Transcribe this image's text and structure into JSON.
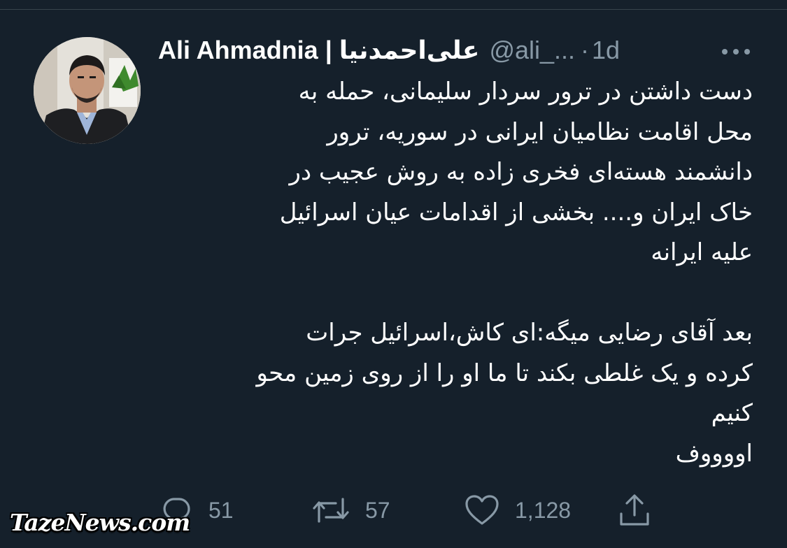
{
  "tweet": {
    "author": {
      "display_name": "Ali Ahmadnia | علی‌احمدنیا",
      "handle": "@ali_...",
      "separator": "·",
      "time": "1d"
    },
    "text_lines": [
      "دست داشتن در ترور سردار سلیمانی، حمله به",
      "محل اقامت نظامیان ایرانی در سوریه، ترور",
      "دانشمند هسته‌ای فخری زاده به روش عجیب در",
      "خاک ایران و.... بخشی از اقدامات عیان اسرائیل",
      "علیه ایرانه",
      "",
      "بعد آقای رضایی میگه:ای کاش،اسرائیل جرات",
      "کرده و یک غلطی بکند تا ما او را از روی زمین محو",
      "کنیم",
      "اووووف"
    ],
    "stats": {
      "replies": "51",
      "retweets": "57",
      "likes": "1,128"
    }
  },
  "watermark": "TazeNews.com",
  "icons": {
    "more": "more-horizontal-icon",
    "reply": "reply-icon",
    "retweet": "retweet-icon",
    "like": "heart-icon",
    "share": "share-icon"
  },
  "colors": {
    "background": "#15202b",
    "text": "#ffffff",
    "secondary": "#8899a6"
  }
}
